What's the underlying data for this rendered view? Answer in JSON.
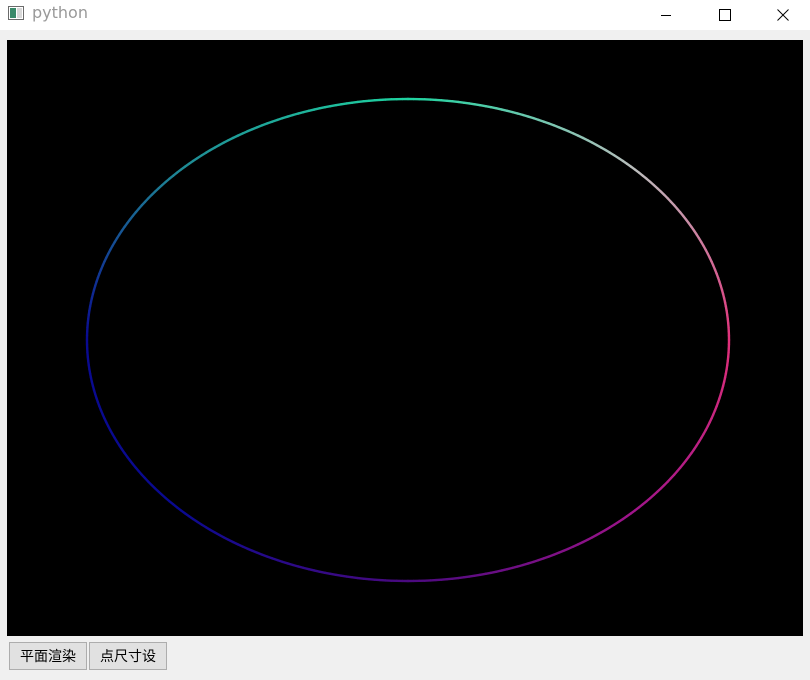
{
  "window": {
    "title": "python"
  },
  "toolbar": {
    "render_button_label": "平面渲染",
    "point_size_button_label": "点尺寸设"
  },
  "canvas": {
    "background": "#000000",
    "ellipse": {
      "gradient_colors": [
        "#1fd3a0",
        "#bdbdbd",
        "#e0307a",
        "#a0158a",
        "#4a0a80",
        "#0a0a90",
        "#0a0a90",
        "#1f8a95",
        "#1fd3a0"
      ]
    }
  },
  "colors": {
    "titlebar_bg": "#ffffff",
    "client_bg": "#f0f0f0",
    "button_bg": "#e1e1e1",
    "button_border": "#adadad"
  }
}
